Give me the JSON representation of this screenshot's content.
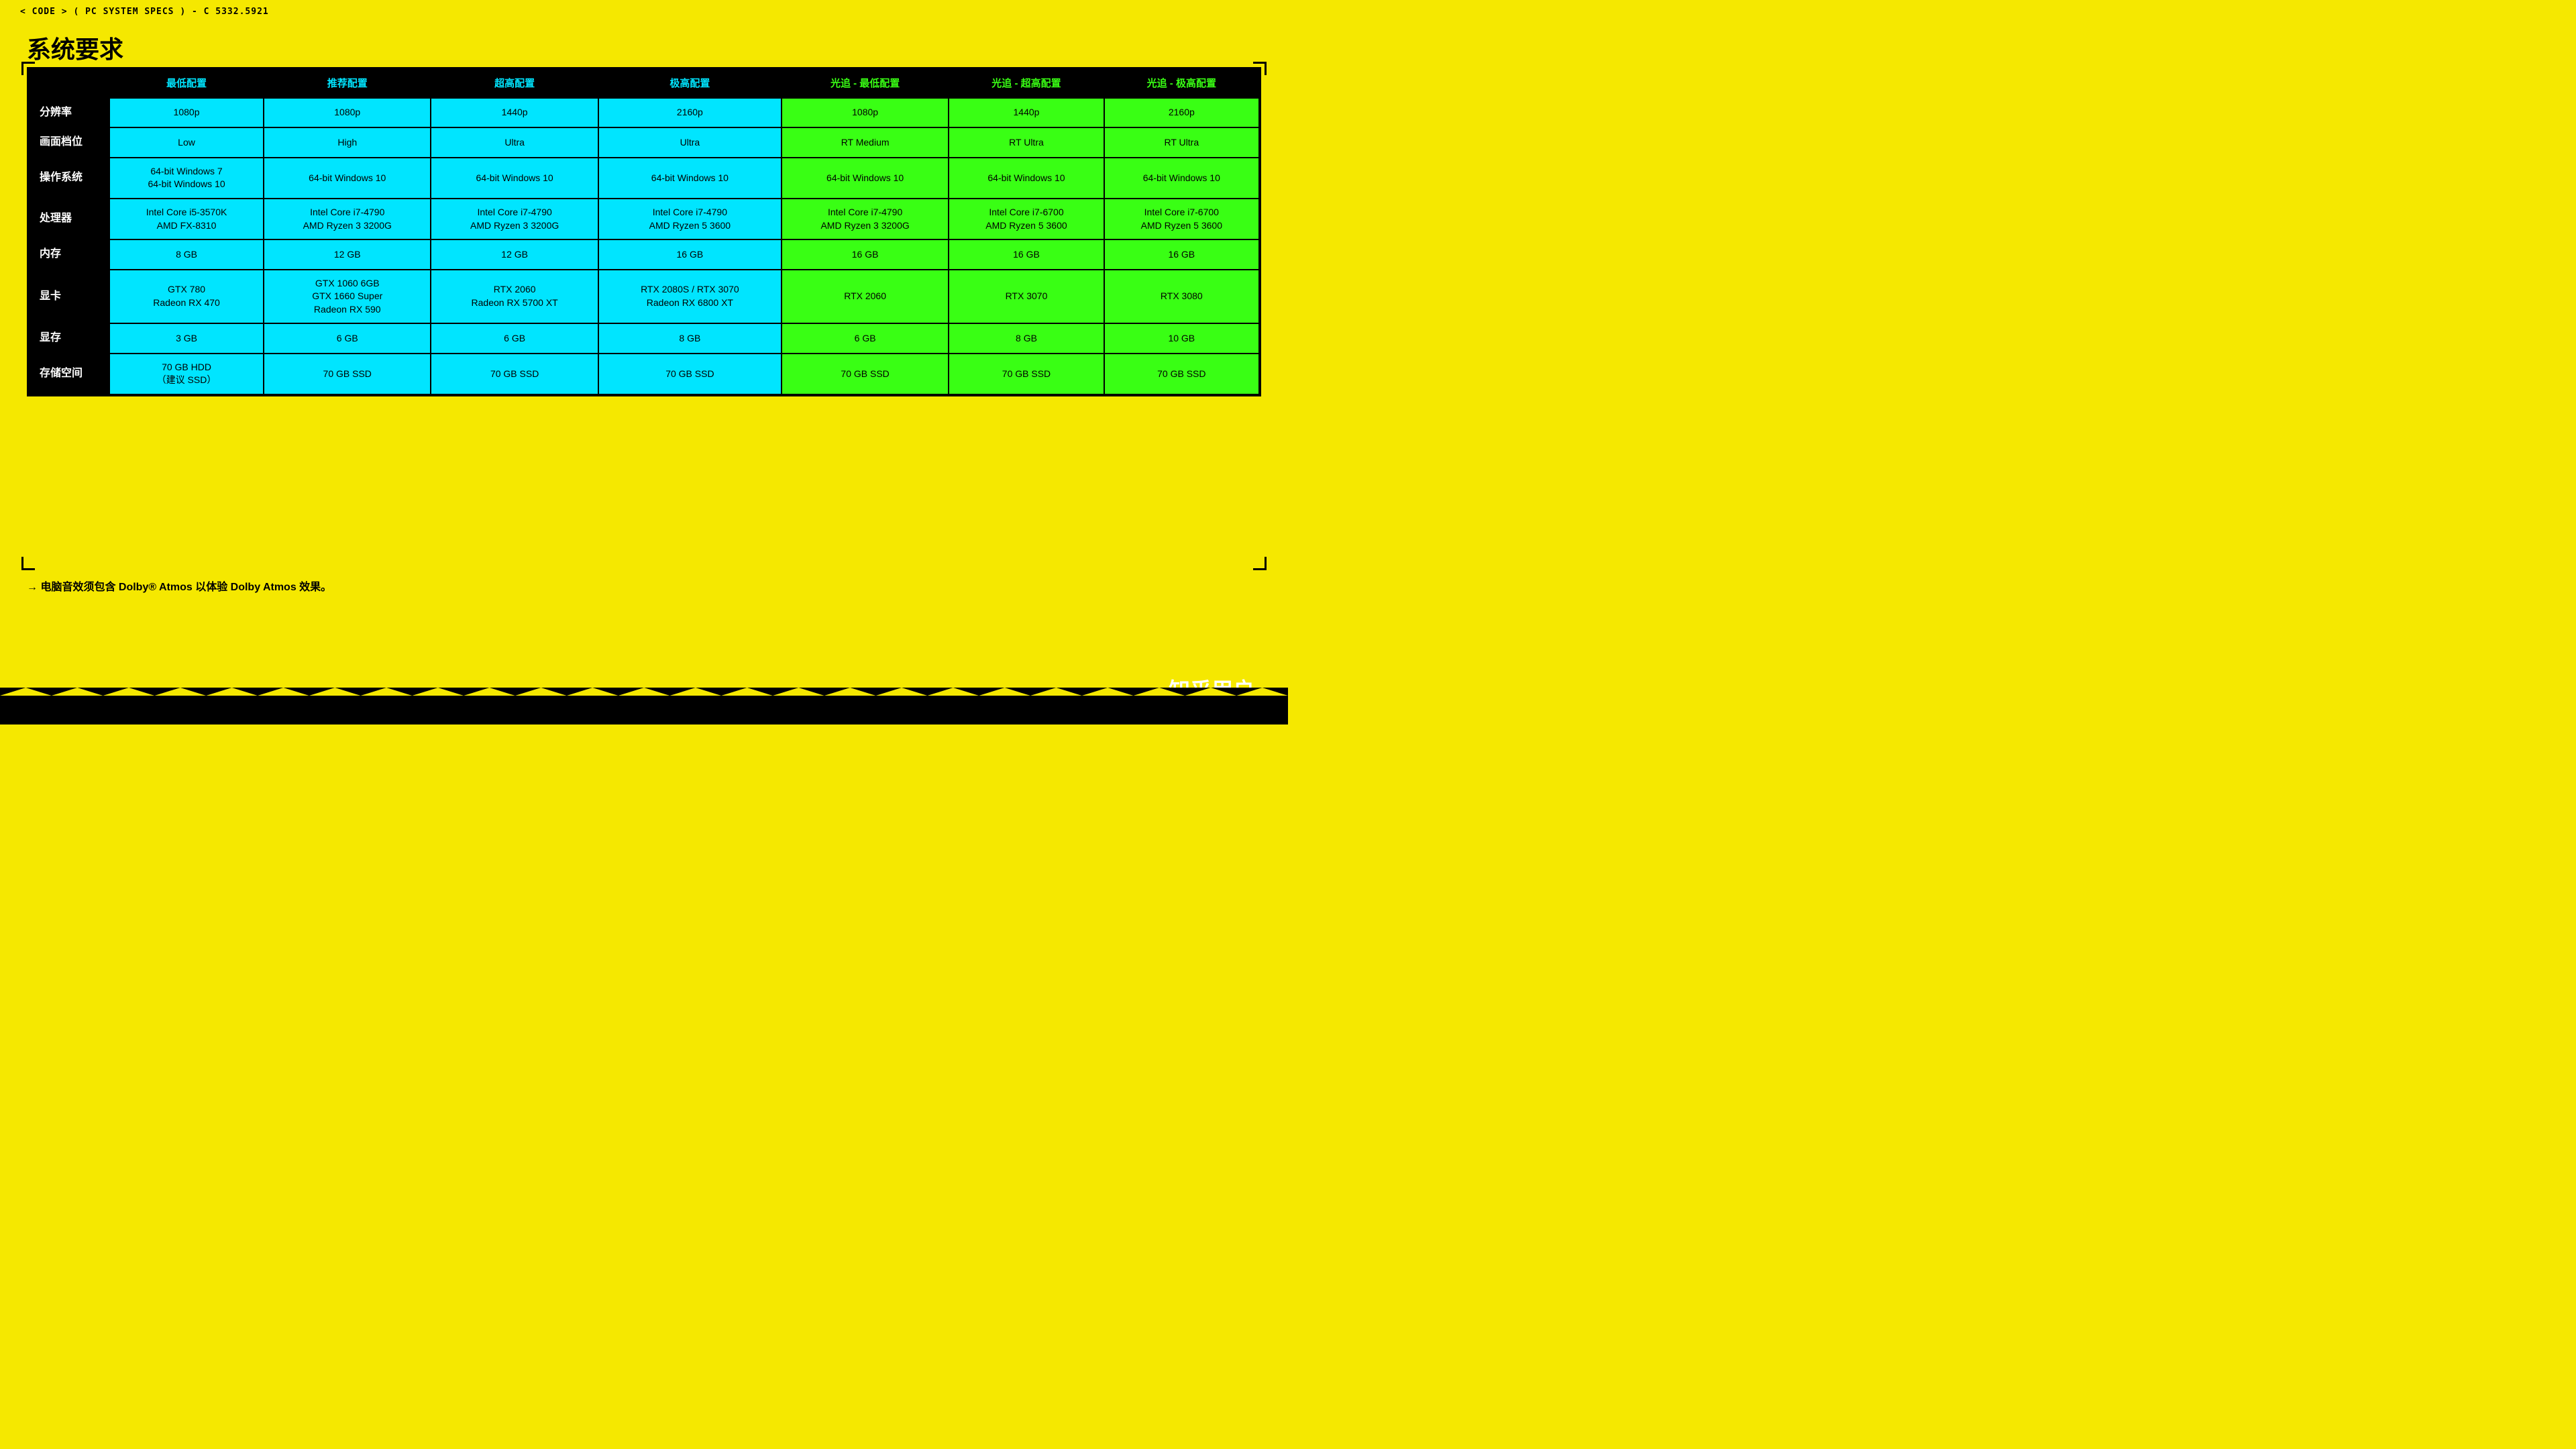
{
  "topBar": {
    "text": "< CODE > ( PC SYSTEM SPECS ) - C 5332.5921"
  },
  "pageTitle": "系统要求",
  "table": {
    "headers": [
      {
        "label": "",
        "type": "empty"
      },
      {
        "label": "最低配置",
        "type": "cyan"
      },
      {
        "label": "推荐配置",
        "type": "cyan"
      },
      {
        "label": "超高配置",
        "type": "cyan"
      },
      {
        "label": "极高配置",
        "type": "cyan"
      },
      {
        "label": "光追 - 最低配置",
        "type": "green"
      },
      {
        "label": "光追 - 超高配置",
        "type": "green"
      },
      {
        "label": "光追 - 极高配置",
        "type": "green"
      }
    ],
    "rows": [
      {
        "label": "分辨率",
        "cells": [
          {
            "text": "1080p",
            "type": "cyan"
          },
          {
            "text": "1080p",
            "type": "cyan"
          },
          {
            "text": "1440p",
            "type": "cyan"
          },
          {
            "text": "2160p",
            "type": "cyan"
          },
          {
            "text": "1080p",
            "type": "green"
          },
          {
            "text": "1440p",
            "type": "green"
          },
          {
            "text": "2160p",
            "type": "green"
          }
        ]
      },
      {
        "label": "画面档位",
        "cells": [
          {
            "text": "Low",
            "type": "cyan"
          },
          {
            "text": "High",
            "type": "cyan"
          },
          {
            "text": "Ultra",
            "type": "cyan"
          },
          {
            "text": "Ultra",
            "type": "cyan"
          },
          {
            "text": "RT Medium",
            "type": "green"
          },
          {
            "text": "RT Ultra",
            "type": "green"
          },
          {
            "text": "RT Ultra",
            "type": "green"
          }
        ]
      },
      {
        "label": "操作系统",
        "cells": [
          {
            "text": "64-bit Windows 7\n64-bit Windows 10",
            "type": "cyan"
          },
          {
            "text": "64-bit Windows 10",
            "type": "cyan"
          },
          {
            "text": "64-bit Windows 10",
            "type": "cyan"
          },
          {
            "text": "64-bit Windows 10",
            "type": "cyan"
          },
          {
            "text": "64-bit Windows 10",
            "type": "green"
          },
          {
            "text": "64-bit Windows 10",
            "type": "green"
          },
          {
            "text": "64-bit Windows 10",
            "type": "green"
          }
        ]
      },
      {
        "label": "处理器",
        "cells": [
          {
            "text": "Intel Core i5-3570K\nAMD FX-8310",
            "type": "cyan"
          },
          {
            "text": "Intel Core i7-4790\nAMD Ryzen 3 3200G",
            "type": "cyan"
          },
          {
            "text": "Intel Core i7-4790\nAMD Ryzen 3 3200G",
            "type": "cyan"
          },
          {
            "text": "Intel Core i7-4790\nAMD Ryzen 5 3600",
            "type": "cyan"
          },
          {
            "text": "Intel Core i7-4790\nAMD Ryzen 3 3200G",
            "type": "green"
          },
          {
            "text": "Intel Core i7-6700\nAMD Ryzen 5 3600",
            "type": "green"
          },
          {
            "text": "Intel Core i7-6700\nAMD Ryzen 5 3600",
            "type": "green"
          }
        ]
      },
      {
        "label": "内存",
        "cells": [
          {
            "text": "8 GB",
            "type": "cyan"
          },
          {
            "text": "12 GB",
            "type": "cyan"
          },
          {
            "text": "12 GB",
            "type": "cyan"
          },
          {
            "text": "16 GB",
            "type": "cyan"
          },
          {
            "text": "16 GB",
            "type": "green"
          },
          {
            "text": "16 GB",
            "type": "green"
          },
          {
            "text": "16 GB",
            "type": "green"
          }
        ]
      },
      {
        "label": "显卡",
        "cells": [
          {
            "text": "GTX 780\nRadeon RX 470",
            "type": "cyan"
          },
          {
            "text": "GTX 1060 6GB\nGTX 1660 Super\nRadeon RX 590",
            "type": "cyan"
          },
          {
            "text": "RTX 2060\nRadeon RX 5700 XT",
            "type": "cyan"
          },
          {
            "text": "RTX 2080S / RTX 3070\nRadeon RX 6800 XT",
            "type": "cyan"
          },
          {
            "text": "RTX 2060",
            "type": "green"
          },
          {
            "text": "RTX 3070",
            "type": "green"
          },
          {
            "text": "RTX 3080",
            "type": "green"
          }
        ]
      },
      {
        "label": "显存",
        "cells": [
          {
            "text": "3 GB",
            "type": "cyan"
          },
          {
            "text": "6 GB",
            "type": "cyan"
          },
          {
            "text": "6 GB",
            "type": "cyan"
          },
          {
            "text": "8 GB",
            "type": "cyan"
          },
          {
            "text": "6 GB",
            "type": "green"
          },
          {
            "text": "8 GB",
            "type": "green"
          },
          {
            "text": "10 GB",
            "type": "green"
          }
        ]
      },
      {
        "label": "存储空间",
        "cells": [
          {
            "text": "70 GB HDD\n（建议 SSD）",
            "type": "cyan"
          },
          {
            "text": "70 GB SSD",
            "type": "cyan"
          },
          {
            "text": "70 GB SSD",
            "type": "cyan"
          },
          {
            "text": "70 GB SSD",
            "type": "cyan"
          },
          {
            "text": "70 GB SSD",
            "type": "green"
          },
          {
            "text": "70 GB SSD",
            "type": "green"
          },
          {
            "text": "70 GB SSD",
            "type": "green"
          }
        ]
      }
    ]
  },
  "footerNote": "→ 电脑音效须包含 Dolby® Atmos 以体验 Dolby Atmos 效果。",
  "watermark": "知乎用户"
}
